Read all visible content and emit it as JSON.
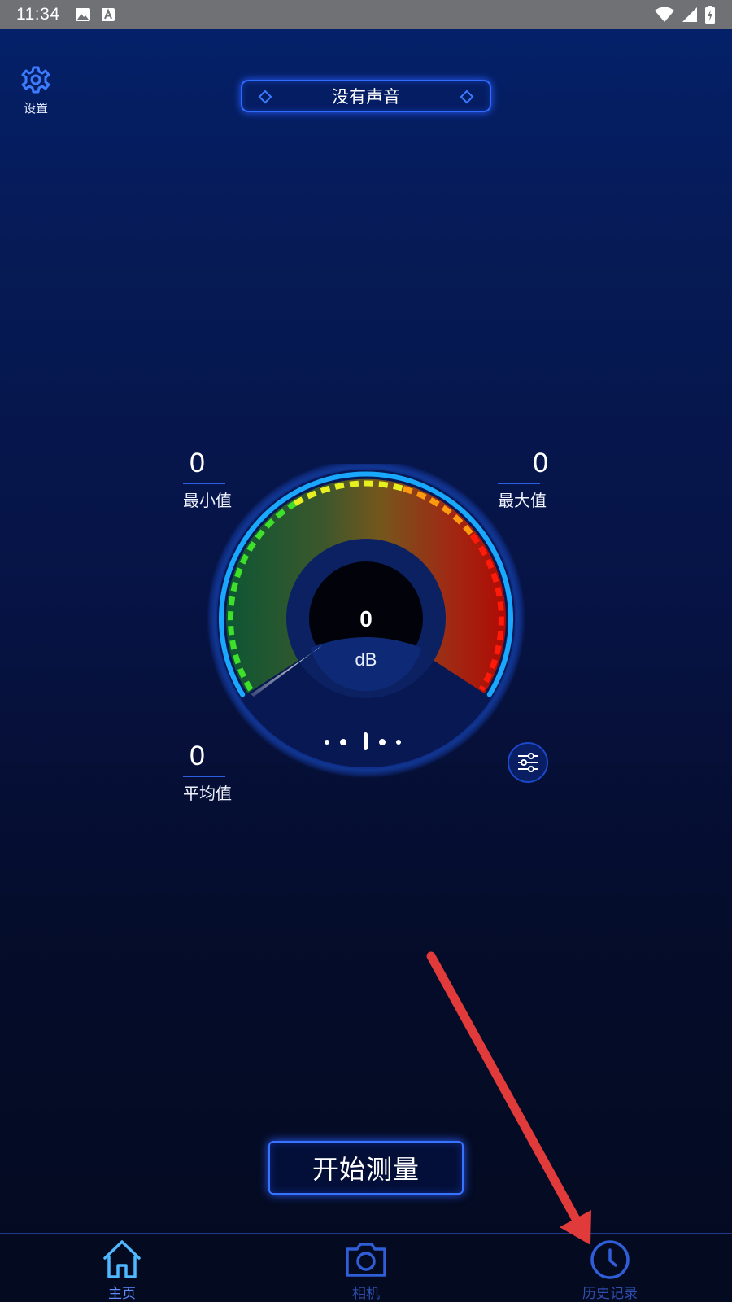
{
  "status_bar": {
    "time": "11:34"
  },
  "settings": {
    "label": "设置"
  },
  "sound_status": {
    "text": "没有声音"
  },
  "stats": {
    "min": {
      "value": "0",
      "label": "最小值"
    },
    "max": {
      "value": "0",
      "label": "最大值"
    },
    "avg": {
      "value": "0",
      "label": "平均值"
    }
  },
  "gauge": {
    "value": "0",
    "unit": "dB"
  },
  "start_button": {
    "label": "开始测量"
  },
  "nav": {
    "home": "主页",
    "camera": "相机",
    "history": "历史记录"
  },
  "colors": {
    "accent": "#2f6bff",
    "annotation_arrow": "#e03a3a"
  }
}
